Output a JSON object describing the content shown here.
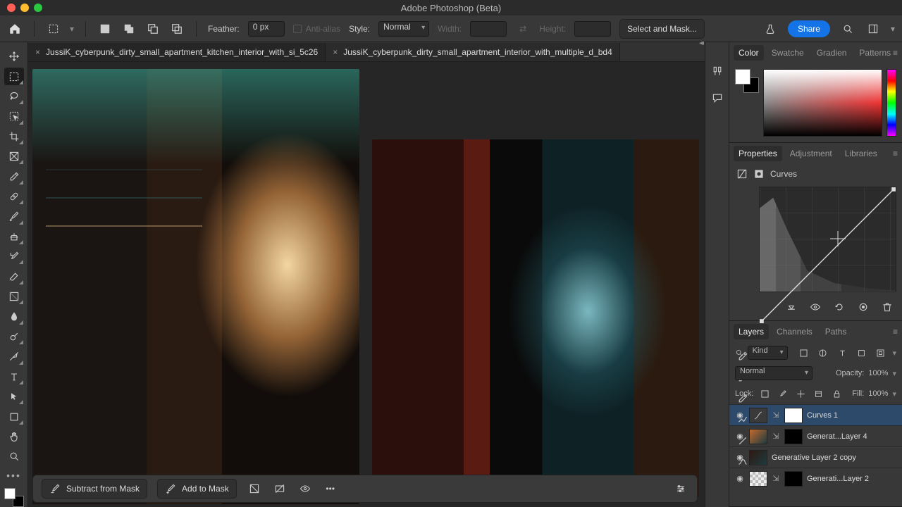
{
  "app_title": "Adobe Photoshop (Beta)",
  "optbar": {
    "feather_label": "Feather:",
    "feather_value": "0 px",
    "antialias_label": "Anti-alias",
    "style_label": "Style:",
    "style_value": "Normal",
    "width_label": "Width:",
    "height_label": "Height:",
    "select_mask": "Select and Mask...",
    "share": "Share"
  },
  "tabs": [
    "JussiK_cyberpunk_dirty_small_apartment_kitchen_interior_with_si_5c26",
    "JussiK_cyberpunk_dirty_small_apartment_interior_with_multiple_d_bd4"
  ],
  "maskbar": {
    "subtract": "Subtract from Mask",
    "add": "Add to Mask"
  },
  "panel_tabs": {
    "color": "Color",
    "swatches": "Swatche",
    "gradients": "Gradien",
    "patterns": "Patterns",
    "properties": "Properties",
    "adjustments": "Adjustment",
    "libraries": "Libraries",
    "layers": "Layers",
    "channels": "Channels",
    "paths": "Paths"
  },
  "properties": {
    "title": "Curves"
  },
  "layers_panel": {
    "filter_kind": "Kind",
    "blend_mode": "Normal",
    "opacity_label": "Opacity:",
    "opacity_value": "100%",
    "lock_label": "Lock:",
    "fill_label": "Fill:",
    "fill_value": "100%",
    "items": [
      {
        "name": "Curves 1"
      },
      {
        "name": "Generat...Layer 4"
      },
      {
        "name": "Generative Layer 2 copy"
      },
      {
        "name": "Generati...Layer 2"
      }
    ]
  }
}
